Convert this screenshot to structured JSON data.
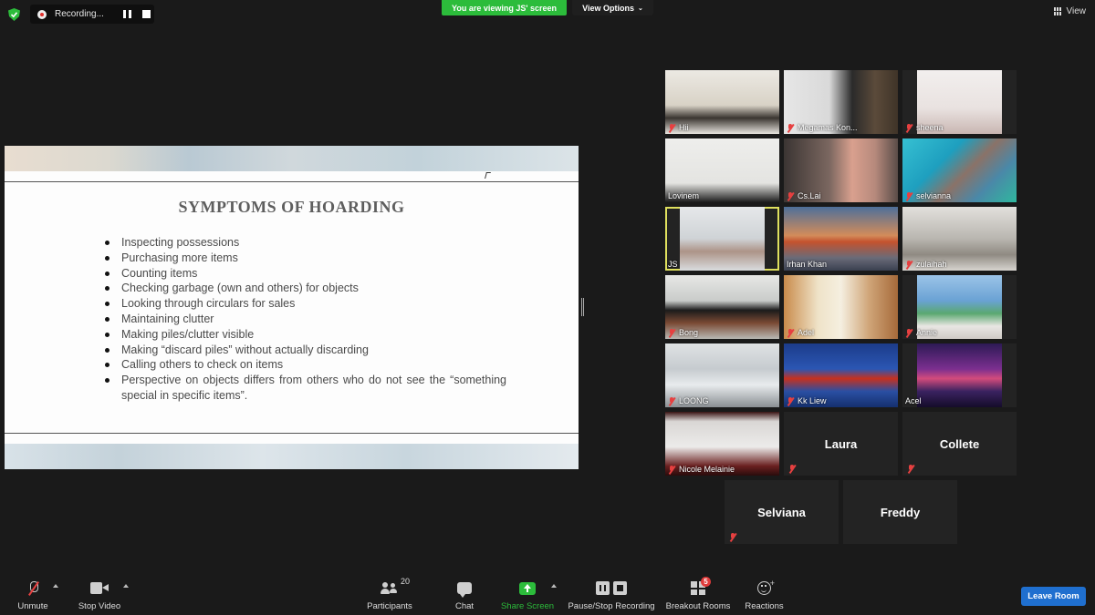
{
  "top": {
    "recording_label": "Recording...",
    "viewing_label": "You are viewing JS' screen",
    "view_options_label": "View Options",
    "view_label": "View",
    "viewing_color": "#2cbc3b"
  },
  "slide": {
    "title": "SYMPTOMS OF HOARDING",
    "bullets": [
      "Inspecting possessions",
      "Purchasing more items",
      "Counting items",
      "Checking garbage (own and others) for objects",
      " Looking through circulars for sales",
      "Maintaining clutter",
      "Making piles/clutter visible",
      "Making “discard piles” without actually discarding",
      " Calling others to check on items",
      "Perspective on objects differs from others who do not see the “something special in specific items”."
    ]
  },
  "gallery": [
    {
      "name": "Hii",
      "muted": true
    },
    {
      "name": "Megamas Kon...",
      "muted": true
    },
    {
      "name": "sheena",
      "muted": true
    },
    {
      "name": "Lovinem",
      "muted": false
    },
    {
      "name": "Cs.Lai",
      "muted": true
    },
    {
      "name": "selvianna",
      "muted": true
    },
    {
      "name": "JS",
      "muted": false,
      "active": true
    },
    {
      "name": "Irhan Khan",
      "muted": false
    },
    {
      "name": "zulaihah",
      "muted": true
    },
    {
      "name": "Bong",
      "muted": true
    },
    {
      "name": "Adel",
      "muted": true
    },
    {
      "name": "Annie",
      "muted": true
    },
    {
      "name": "LOONG",
      "muted": true
    },
    {
      "name": "Kk Liew",
      "muted": true
    },
    {
      "name": "Acel",
      "muted": false
    },
    {
      "name": "Nicole Melainie",
      "muted": true
    },
    {
      "name": "Laura",
      "muted": true,
      "video_off": true
    },
    {
      "name": "Collete",
      "muted": true,
      "video_off": true
    },
    {
      "name": "Selviana",
      "muted": true,
      "video_off": true
    },
    {
      "name": "Freddy",
      "muted": false,
      "video_off": true
    }
  ],
  "toolbar": {
    "unmute": "Unmute",
    "stop_video": "Stop Video",
    "participants": "Participants",
    "participants_count": "20",
    "chat": "Chat",
    "share_screen": "Share Screen",
    "pause_stop_recording": "Pause/Stop Recording",
    "breakout_rooms": "Breakout Rooms",
    "breakout_badge": "5",
    "reactions": "Reactions",
    "leave_room": "Leave Room",
    "leave_color": "#1f6fcf"
  }
}
